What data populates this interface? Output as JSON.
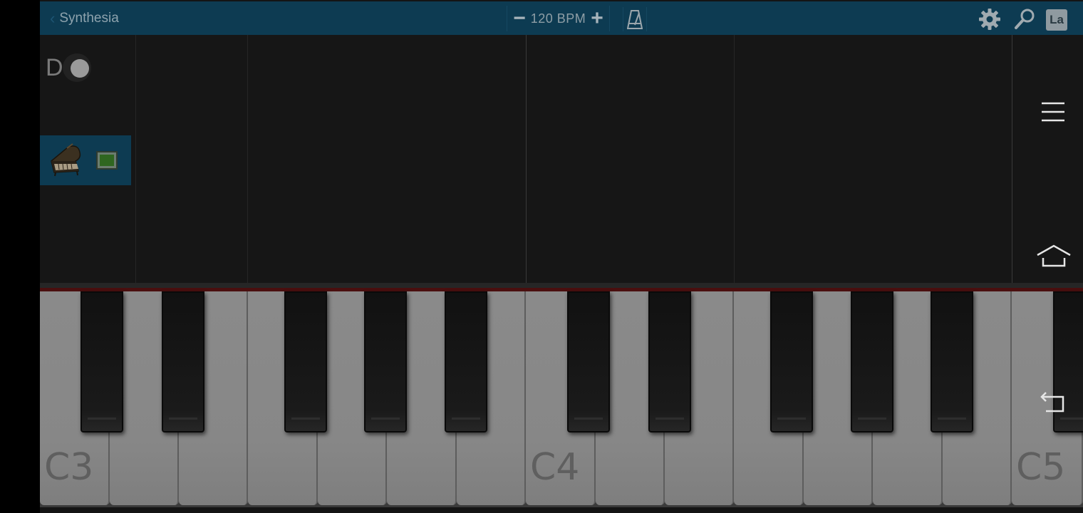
{
  "topbar": {
    "title": "Synthesia",
    "back_icon": "chevron-left-icon",
    "tempo_minus": "−",
    "tempo_label": "120 BPM",
    "tempo_plus": "+",
    "metronome_icon": "metronome-icon",
    "settings_icon": "gear-icon",
    "search_icon": "search-icon",
    "labels_button": "La",
    "bar_color": "#0d3b52"
  },
  "track": {
    "dot_letter": "D",
    "instrument_icon": "grand-piano-icon",
    "color_swatch": "#2f6620"
  },
  "keyboard": {
    "labels": [
      "C3",
      "C4",
      "C5"
    ]
  },
  "nav": {
    "menu_icon": "menu-icon",
    "home_icon": "home-icon",
    "back_icon": "back-icon"
  }
}
